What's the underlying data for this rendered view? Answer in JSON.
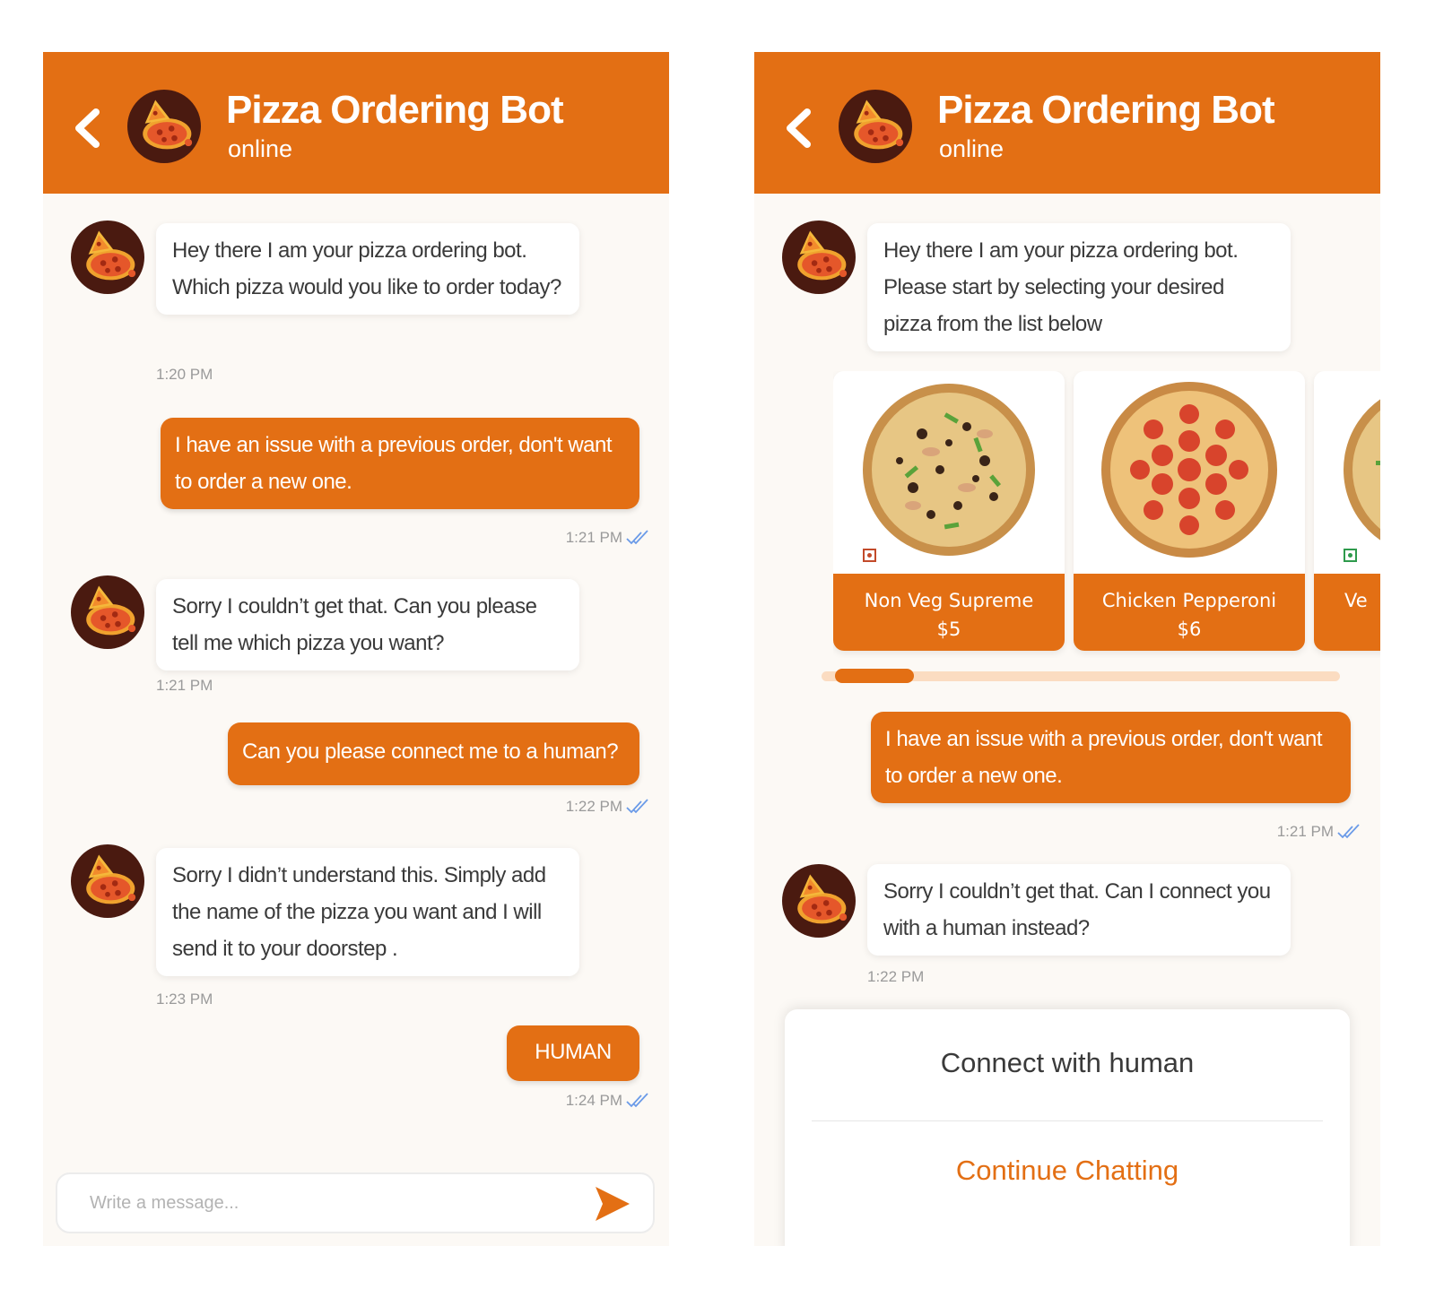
{
  "colors": {
    "brand": "#e36f14",
    "chat_background": "#fcf9f5",
    "bot_bubble": "#ffffff",
    "timestamp": "#9a9a9a",
    "read_receipt": "#6b9be8",
    "veg_mark": "#2e9a4c",
    "nonveg_mark": "#c24a2a"
  },
  "left_screen": {
    "header": {
      "title": "Pizza Ordering Bot",
      "status": "online",
      "back_icon": "chevron-left-icon",
      "avatar_icon": "pizza-logo-icon"
    },
    "messages": [
      {
        "sender": "bot",
        "text": "Hey there I am your pizza ordering bot. Which pizza would you like to order today?",
        "time": "1:20 PM"
      },
      {
        "sender": "user",
        "text": "I have an issue with a previous order, don't want to order a new one.",
        "time": "1:21 PM",
        "read_icon": "double-check-icon"
      },
      {
        "sender": "bot",
        "text": "Sorry I couldn’t get that. Can you please tell me which pizza you want?",
        "time": "1:21 PM"
      },
      {
        "sender": "user",
        "text": "Can you please connect me to a human?",
        "time": "1:22 PM",
        "read_icon": "double-check-icon"
      },
      {
        "sender": "bot",
        "text": "Sorry I didn’t understand this. Simply add the name of the pizza you want and I will send it to your doorstep .",
        "time": "1:23 PM"
      },
      {
        "sender": "user",
        "text": "HUMAN",
        "time": "1:24 PM",
        "read_icon": "double-check-icon"
      }
    ],
    "composer": {
      "placeholder": "Write a message...",
      "value": "",
      "send_icon": "send-icon"
    }
  },
  "right_screen": {
    "header": {
      "title": "Pizza Ordering Bot",
      "status": "online",
      "back_icon": "chevron-left-icon",
      "avatar_icon": "pizza-logo-icon"
    },
    "bot_intro": {
      "text": "Hey there I am your pizza ordering bot. Please start by selecting your desired pizza from the list below"
    },
    "carousel": {
      "items": [
        {
          "name": "Non Veg Supreme",
          "price": "$5",
          "type": "non-veg",
          "image_icon": "supreme-pizza-icon"
        },
        {
          "name": "Chicken Pepperoni",
          "price": "$6",
          "type": "non-veg",
          "image_icon": "pepperoni-pizza-icon"
        },
        {
          "name": "Ve",
          "price": "",
          "type": "veg",
          "image_icon": "veg-pizza-icon"
        }
      ],
      "scroll_position": 0.15
    },
    "messages": [
      {
        "sender": "user",
        "text": "I have an issue with a previous order, don't want to order a new one.",
        "time": "1:21 PM",
        "read_icon": "double-check-icon"
      },
      {
        "sender": "bot",
        "text": "Sorry I couldn’t get that. Can I connect you with a human instead?",
        "time": "1:22 PM"
      }
    ],
    "modal": {
      "primary_label": "Connect with human",
      "secondary_label": "Continue Chatting"
    }
  }
}
